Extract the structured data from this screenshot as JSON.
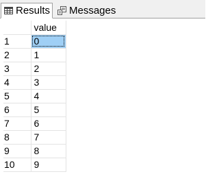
{
  "tabs": {
    "results_label": "Results",
    "messages_label": "Messages"
  },
  "grid": {
    "columns": [
      "value"
    ],
    "rows": [
      {
        "num": "1",
        "value": "0",
        "selected": true
      },
      {
        "num": "2",
        "value": "1"
      },
      {
        "num": "3",
        "value": "2"
      },
      {
        "num": "4",
        "value": "3"
      },
      {
        "num": "5",
        "value": "4"
      },
      {
        "num": "6",
        "value": "5"
      },
      {
        "num": "7",
        "value": "6"
      },
      {
        "num": "8",
        "value": "7"
      },
      {
        "num": "9",
        "value": "8"
      },
      {
        "num": "10",
        "value": "9"
      }
    ]
  },
  "colors": {
    "selection": "#9fcff5",
    "tabbar_bg": "#f0f0f0",
    "gridline": "#e3e3e3"
  },
  "icons": {
    "results": "grid-icon",
    "messages": "messages-icon"
  }
}
